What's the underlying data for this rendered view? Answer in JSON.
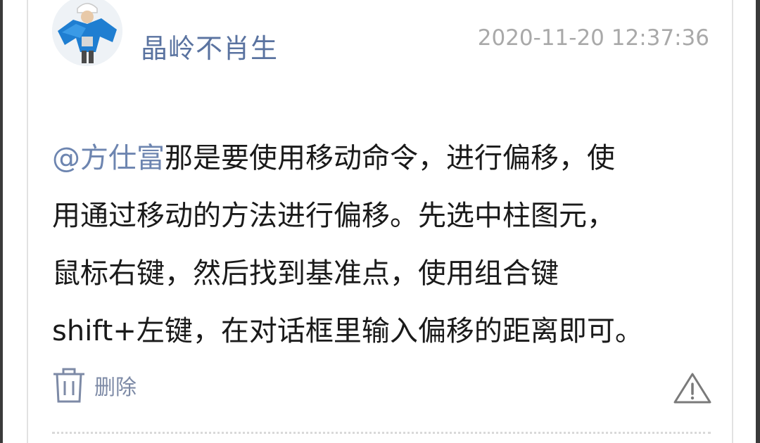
{
  "comment": {
    "author": "晶岭不肖生",
    "timestamp": "2020-11-20 12:37:36",
    "mention": "@方仕富",
    "text_lines": [
      "那是要使用移动命令，进行偏移，使",
      "用通过移动的方法进行偏移。先选中柱图元，",
      "鼠标右键，然后找到基准点，使用组合键",
      "shift+左键，在对话框里输入偏移的距离即可。"
    ],
    "actions": {
      "delete_label": "删除",
      "delete_icon": "trash-icon",
      "report_icon": "warning-triangle-icon"
    }
  },
  "colors": {
    "author": "#5a73a0",
    "mention": "#6d85b0",
    "timestamp": "#a9a9a9",
    "text": "#1a1a1a",
    "action": "#7d8aa6"
  }
}
